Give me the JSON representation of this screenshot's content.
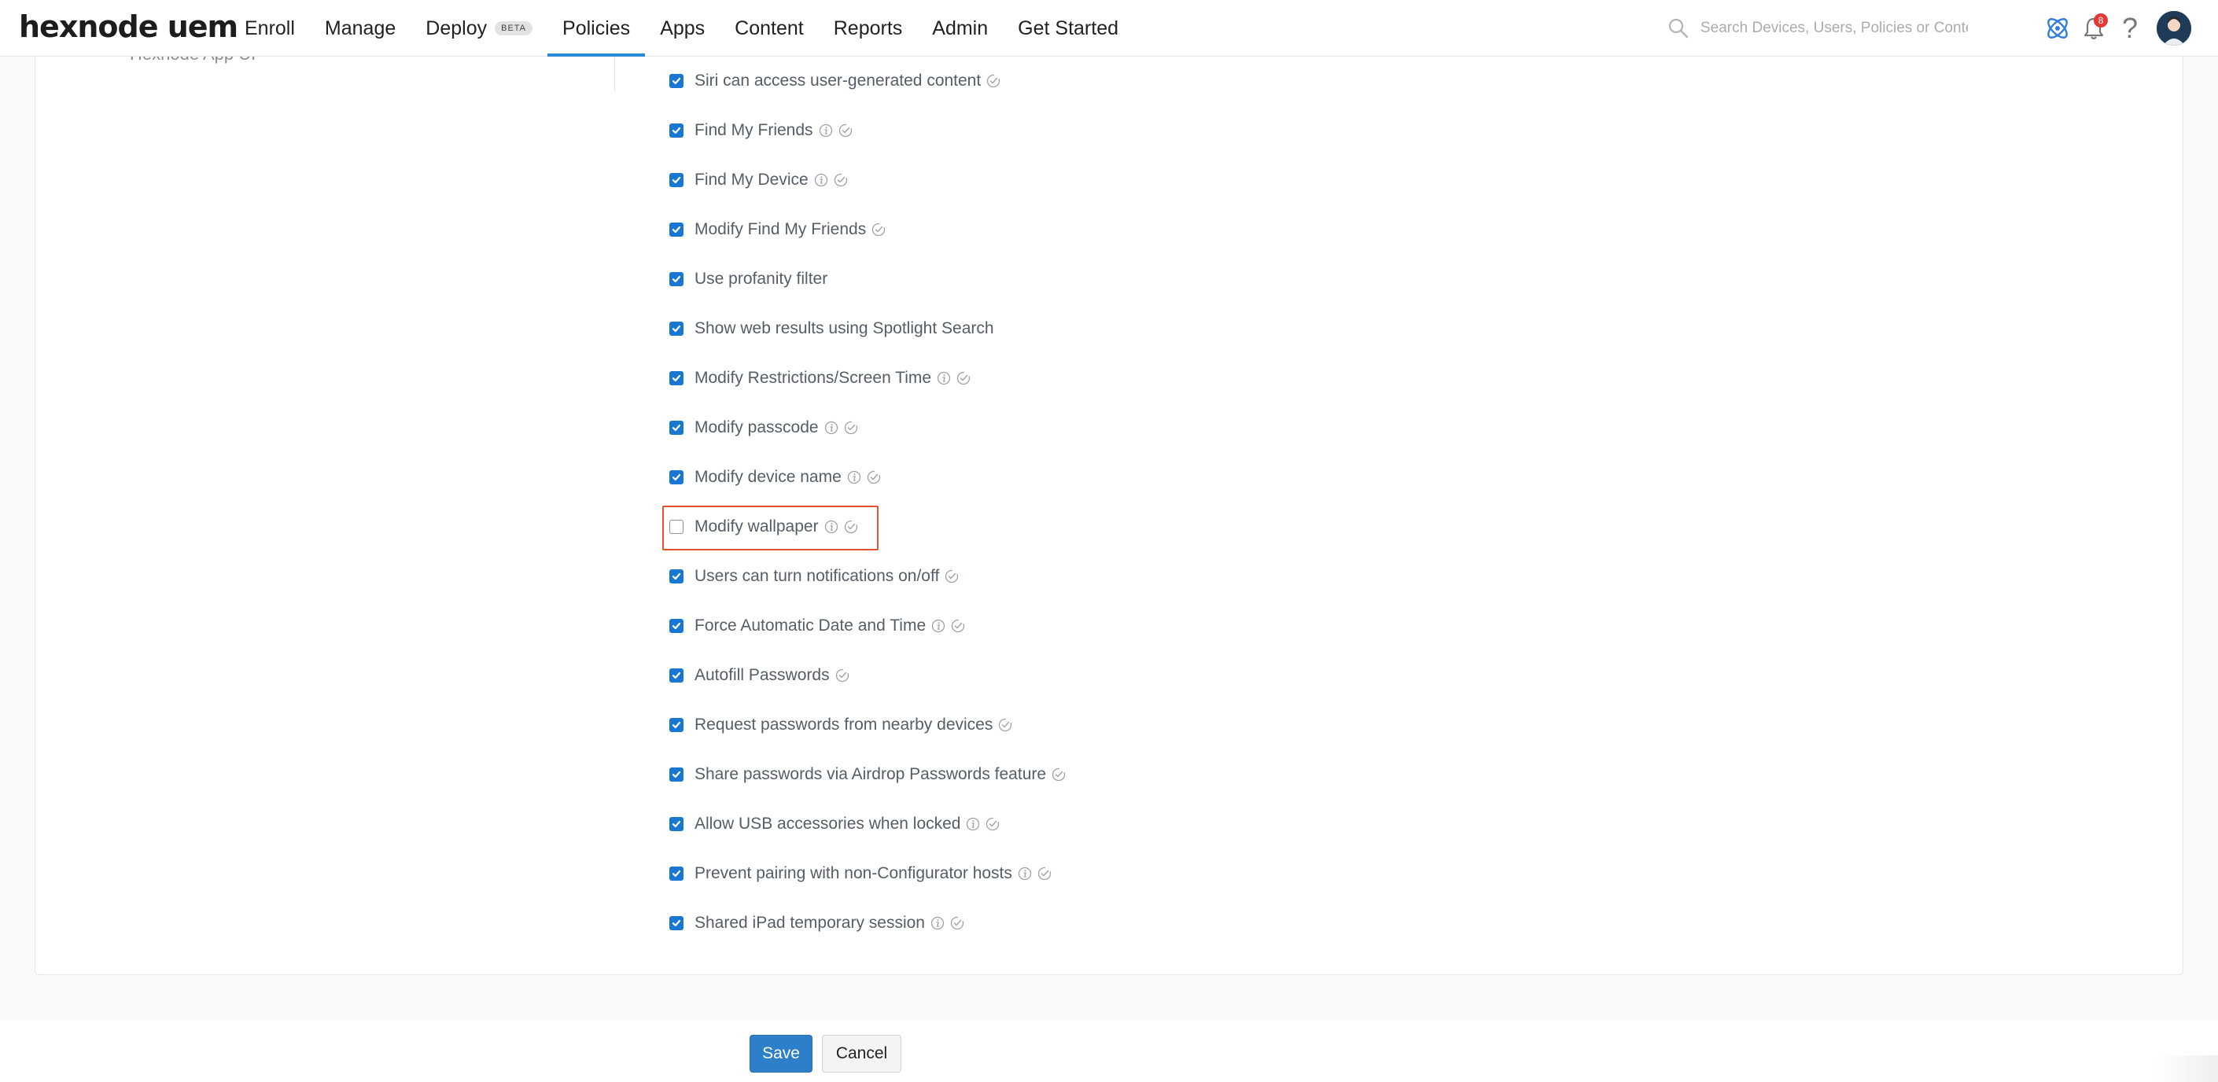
{
  "brand": {
    "logo_text": "hexnode uem"
  },
  "nav": {
    "items": [
      {
        "label": "Enroll"
      },
      {
        "label": "Manage"
      },
      {
        "label": "Deploy",
        "badge": "BETA"
      },
      {
        "label": "Policies",
        "active": true
      },
      {
        "label": "Apps"
      },
      {
        "label": "Content"
      },
      {
        "label": "Reports"
      },
      {
        "label": "Admin"
      },
      {
        "label": "Get Started"
      }
    ]
  },
  "search": {
    "placeholder": "Search Devices, Users, Policies or Content",
    "value": ""
  },
  "top_icons": {
    "network": "network-icon",
    "notifications": {
      "icon": "bell-icon",
      "count": "8"
    },
    "help": {
      "icon": "help-icon",
      "glyph": "?"
    },
    "avatar": "user-avatar"
  },
  "sidebar": {
    "partial_text": "Hexnode App UI"
  },
  "restrictions": [
    {
      "label": "Siri can access user-generated content",
      "checked": true,
      "info": false
    },
    {
      "label": "Find My Friends",
      "checked": true,
      "info": true
    },
    {
      "label": "Find My Device",
      "checked": true,
      "info": true
    },
    {
      "label": "Modify Find My Friends",
      "checked": true,
      "info": false
    },
    {
      "label": "Use profanity filter",
      "checked": true,
      "info": false,
      "supervised": false
    },
    {
      "label": "Show web results using Spotlight Search",
      "checked": true,
      "info": false,
      "supervised": false
    },
    {
      "label": "Modify Restrictions/Screen Time",
      "checked": true,
      "info": true
    },
    {
      "label": "Modify passcode",
      "checked": true,
      "info": true
    },
    {
      "label": "Modify device name",
      "checked": true,
      "info": true
    },
    {
      "label": "Modify wallpaper",
      "checked": false,
      "info": true,
      "highlighted": true
    },
    {
      "label": "Users can turn notifications on/off",
      "checked": true,
      "info": false
    },
    {
      "label": "Force Automatic Date and Time",
      "checked": true,
      "info": true
    },
    {
      "label": "Autofill Passwords",
      "checked": true,
      "info": false
    },
    {
      "label": "Request passwords from nearby devices",
      "checked": true,
      "info": false
    },
    {
      "label": "Share passwords via Airdrop Passwords feature",
      "checked": true,
      "info": false
    },
    {
      "label": "Allow USB accessories when locked",
      "checked": true,
      "info": true
    },
    {
      "label": "Prevent pairing with non-Configurator hosts",
      "checked": true,
      "info": true
    },
    {
      "label": "Shared iPad temporary session",
      "checked": true,
      "info": true
    }
  ],
  "actions": {
    "save_label": "Save",
    "cancel_label": "Cancel"
  },
  "colors": {
    "accent": "#2a88d6",
    "checkbox": "#1877d2",
    "highlight": "#e0532e",
    "badge": "#e53935"
  }
}
